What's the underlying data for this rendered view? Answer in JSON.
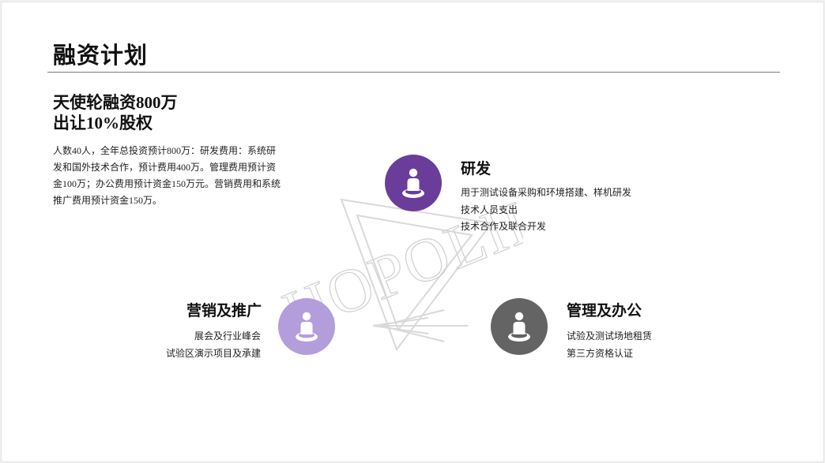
{
  "page": {
    "title": "融资计划"
  },
  "funding": {
    "headline_line1": "天使轮融资800万",
    "headline_line2": "出让10%股权",
    "body": "人数40人，全年总投资预计800万：研发费用：系统研发和国外技术合作，预计费用400万。管理费用预计资金100万；办公费用预计资金150万元。营销费用和系统推广费用预计资金150万。"
  },
  "watermark": {
    "text": "HOPOLIL"
  },
  "sections": {
    "rd": {
      "title": "研发",
      "lines": [
        "用于测试设备采购和环境搭建、样机研发",
        "技术人员支出",
        "技术合作及联合开发"
      ],
      "icon": "person-icon",
      "color": "#6a3d9a"
    },
    "marketing": {
      "title": "营销及推广",
      "lines": [
        "展会及行业峰会",
        "试验区演示项目及承建"
      ],
      "icon": "person-icon",
      "color": "#b39ddb"
    },
    "management": {
      "title": "管理及办公",
      "lines": [
        "试验及测试场地租赁",
        "第三方资格认证"
      ],
      "icon": "person-icon",
      "color": "#646464"
    }
  }
}
